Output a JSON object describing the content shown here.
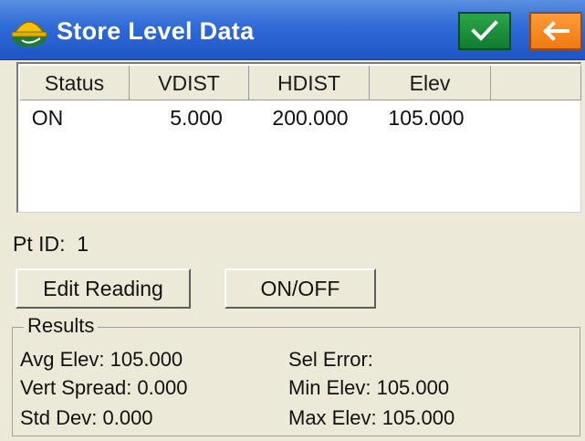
{
  "titlebar": {
    "title": "Store Level Data",
    "app_icon": "surveyor-helmet-icon",
    "ok_icon": "checkmark-icon",
    "back_icon": "back-arrow-icon",
    "colors": {
      "bar": "#2f6ad8",
      "ok": "#0e7c2f",
      "back": "#f07a10"
    }
  },
  "table": {
    "headers": [
      "Status",
      "VDIST",
      "HDIST",
      "Elev"
    ],
    "rows": [
      [
        "ON",
        "5.000",
        "200.000",
        "105.000"
      ]
    ]
  },
  "point": {
    "label": "Pt ID:",
    "value": "1"
  },
  "buttons": {
    "edit_reading": "Edit Reading",
    "on_off": "ON/OFF"
  },
  "results": {
    "legend": "Results",
    "avg_elev": "Avg Elev: 105.000",
    "vert_spread": "Vert Spread: 0.000",
    "std_dev": "Std Dev: 0.000",
    "sel_error": "Sel Error:",
    "min_elev": "Min Elev: 105.000",
    "max_elev": "Max Elev: 105.000"
  }
}
